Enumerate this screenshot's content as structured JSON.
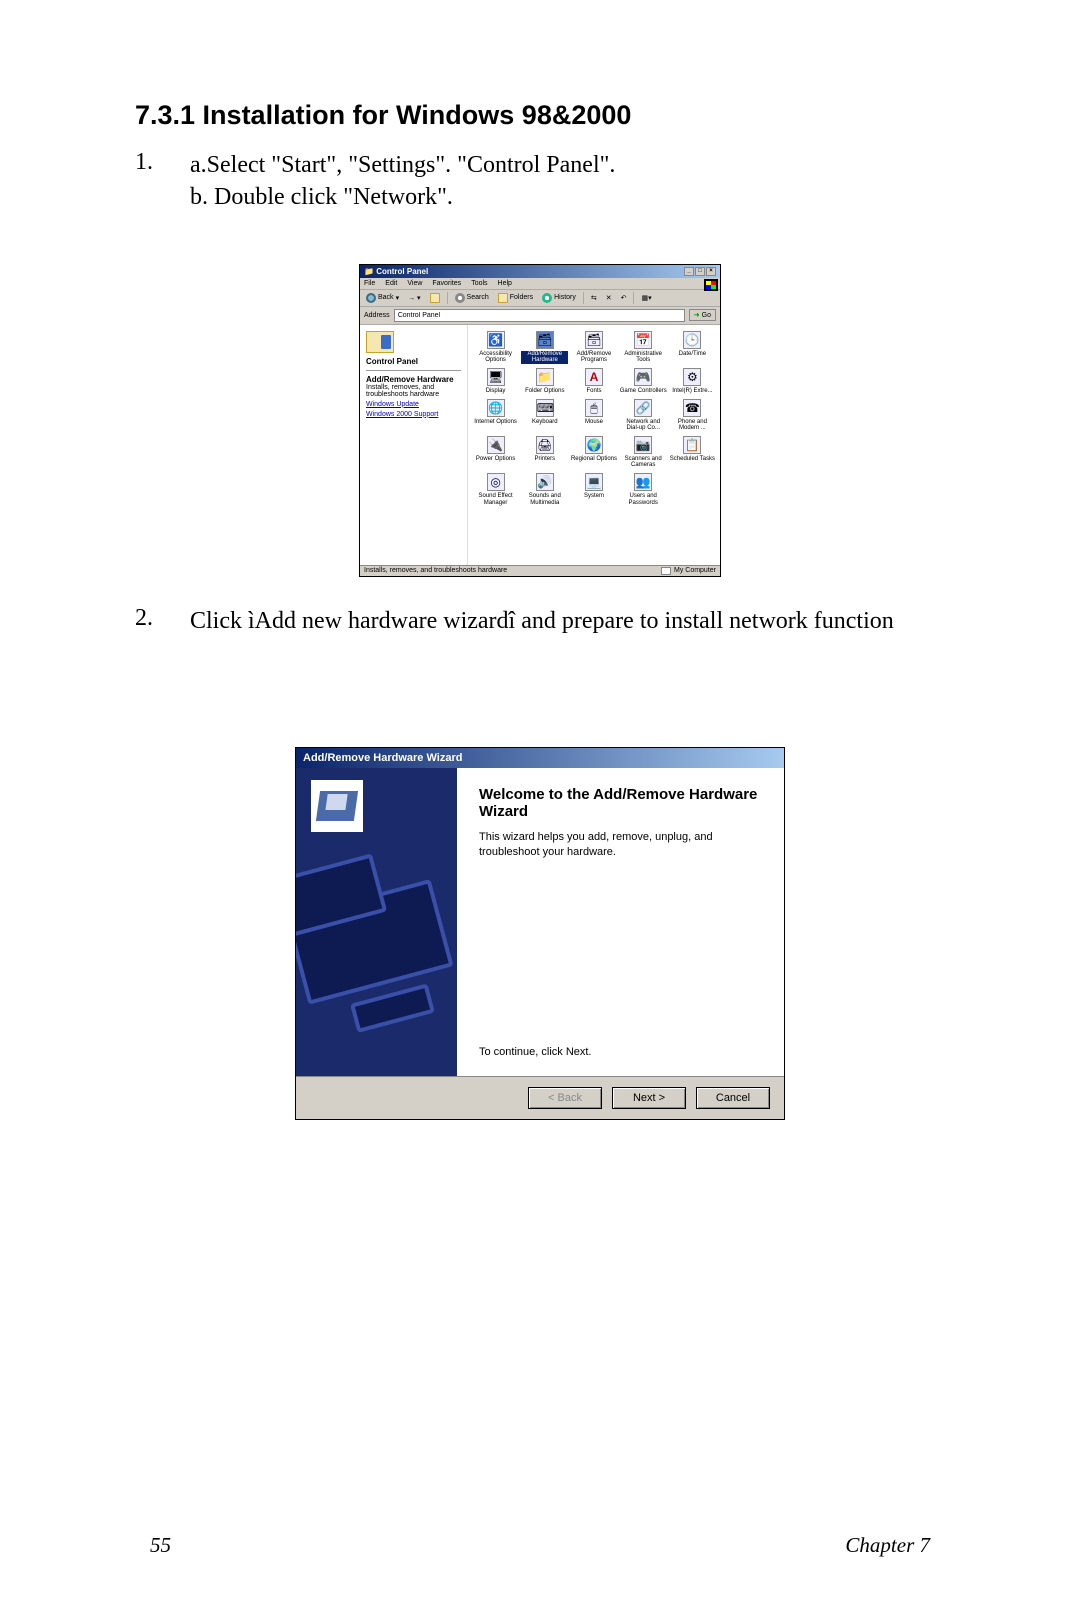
{
  "heading": "7.3.1 Installation for Windows 98&2000",
  "step1_num": "1.",
  "step1_a": "a.Select \"Start\", \"Settings\". \"Control Panel\".",
  "step1_b": "b. Double click \"Network\".",
  "step2_num": "2.",
  "step2_text": "Click ìAdd new hardware wizardî and prepare to install network function",
  "footer_page": "55",
  "footer_chapter": "Chapter 7",
  "cp": {
    "title": "Control Panel",
    "menu": {
      "file": "File",
      "edit": "Edit",
      "view": "View",
      "favorites": "Favorites",
      "tools": "Tools",
      "help": "Help"
    },
    "toolbar": {
      "back": "Back",
      "search": "Search",
      "folders": "Folders",
      "history": "History"
    },
    "address_label": "Address",
    "address_value": "Control Panel",
    "go": "Go",
    "side": {
      "heading": "Control Panel",
      "item_title": "Add/Remove Hardware",
      "item_desc": "Installs, removes, and troubleshoots hardware",
      "link1": "Windows Update",
      "link2": "Windows 2000 Support"
    },
    "icons": {
      "accessibility": "Accessibility Options",
      "addremovehw": "Add/Remove Hardware",
      "addremoveprog": "Add/Remove Programs",
      "admin": "Administrative Tools",
      "datetime": "Date/Time",
      "display": "Display",
      "folderopt": "Folder Options",
      "fonts": "Fonts",
      "game": "Game Controllers",
      "intel": "Intel(R) Extre...",
      "internet": "Internet Options",
      "keyboard": "Keyboard",
      "mouse": "Mouse",
      "network": "Network and Dial-up Co...",
      "phone": "Phone and Modem ...",
      "power": "Power Options",
      "printers": "Printers",
      "regional": "Regional Options",
      "scanners": "Scanners and Cameras",
      "scheduled": "Scheduled Tasks",
      "soundfx": "Sound Effect Manager",
      "sounds": "Sounds and Multimedia",
      "system": "System",
      "users": "Users and Passwords"
    },
    "status_left": "Installs, removes, and troubleshoots hardware",
    "status_right": "My Computer"
  },
  "wiz": {
    "title": "Add/Remove Hardware Wizard",
    "heading": "Welcome to the Add/Remove Hardware Wizard",
    "desc": "This wizard helps you add, remove, unplug, and troubleshoot your hardware.",
    "continue": "To continue, click Next.",
    "back": "< Back",
    "next": "Next >",
    "cancel": "Cancel"
  }
}
